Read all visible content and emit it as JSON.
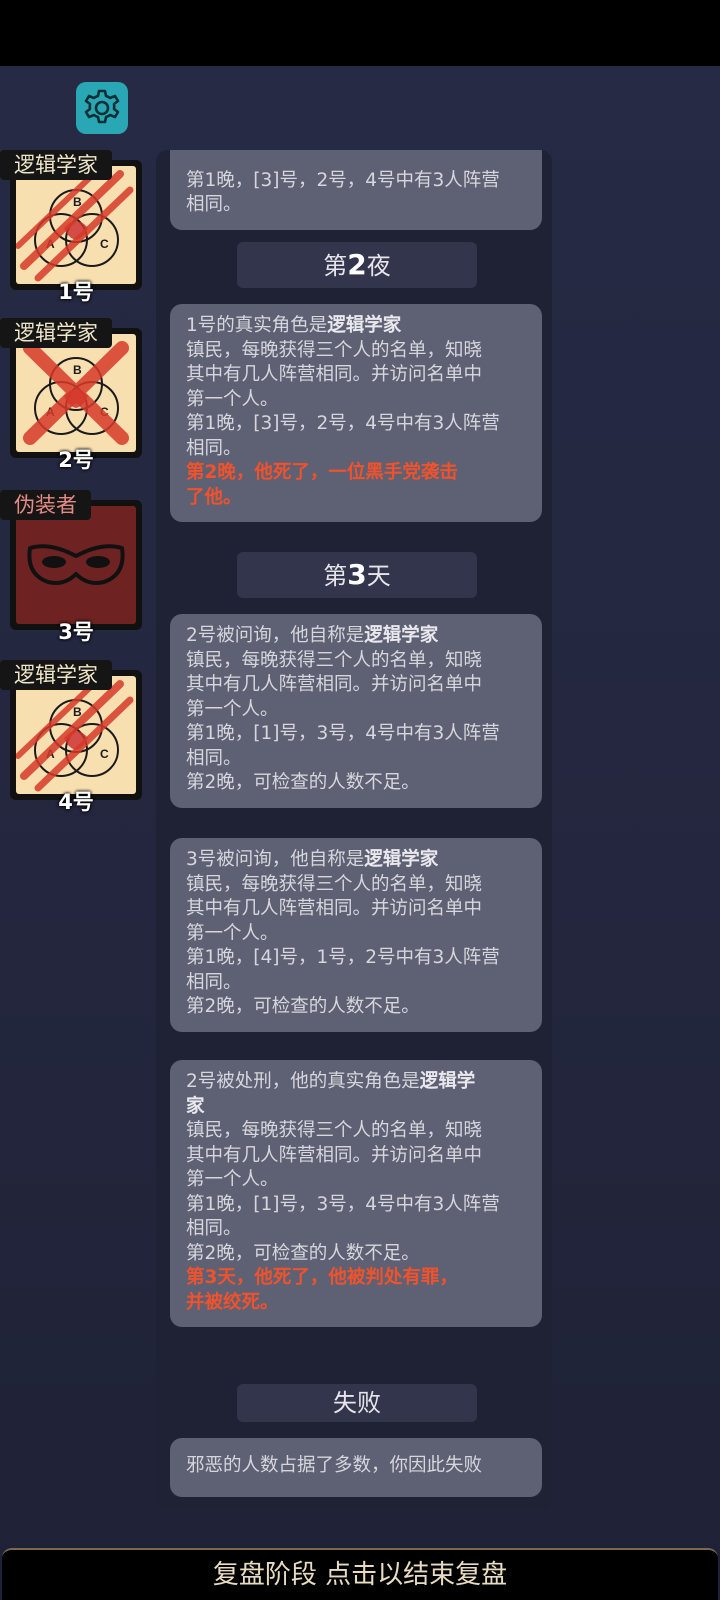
{
  "players": [
    {
      "role": "逻辑学家",
      "number": "1号",
      "faction": "good",
      "state": "attacked"
    },
    {
      "role": "逻辑学家",
      "number": "2号",
      "faction": "good",
      "state": "executed"
    },
    {
      "role": "伪装者",
      "number": "3号",
      "faction": "evil",
      "state": "alive"
    },
    {
      "role": "逻辑学家",
      "number": "4号",
      "faction": "good",
      "state": "attacked"
    }
  ],
  "log": {
    "m0": {
      "l1": "第1晚，[3]号，2号，4号中有3人阵营",
      "l2": "相同。"
    },
    "p_night2": {
      "a": "第",
      "b": "2",
      "c": "夜"
    },
    "m1": {
      "pre": "1号的真实角色是",
      "role": "逻辑学家",
      "d1": "镇民，每晚获得三个人的名单，知晓",
      "d2": "其中有几人阵营相同。并访问名单中",
      "d3": "第一个人。",
      "n1a": "第1晚，[3]号，2号，4号中有3人阵营",
      "n1b": "相同。",
      "r1": "第2晚，他死了，一位黑手党袭击",
      "r2": "了他。"
    },
    "p_day3": {
      "a": "第",
      "b": "3",
      "c": "天"
    },
    "m2": {
      "pre": "2号被问询，他自称是",
      "role": "逻辑学家",
      "d1": "镇民，每晚获得三个人的名单，知晓",
      "d2": "其中有几人阵营相同。并访问名单中",
      "d3": "第一个人。",
      "n1a": "第1晚，[1]号，3号，4号中有3人阵营",
      "n1b": "相同。",
      "n2": "第2晚，可检查的人数不足。"
    },
    "m3": {
      "pre": "3号被问询，他自称是",
      "role": "逻辑学家",
      "d1": "镇民，每晚获得三个人的名单，知晓",
      "d2": "其中有几人阵营相同。并访问名单中",
      "d3": "第一个人。",
      "n1a": "第1晚，[4]号，1号，2号中有3人阵营",
      "n1b": "相同。",
      "n2": "第2晚，可检查的人数不足。"
    },
    "m4": {
      "pre": "2号被处刑，他的真实角色是",
      "role_a": "逻辑学",
      "role_b": "家",
      "d1": "镇民，每晚获得三个人的名单，知晓",
      "d2": "其中有几人阵营相同。并访问名单中",
      "d3": "第一个人。",
      "n1a": "第1晚，[1]号，3号，4号中有3人阵营",
      "n1b": "相同。",
      "n2": "第2晚，可检查的人数不足。",
      "r1": "第3天，他死了，他被判处有罪，",
      "r2": "并被绞死。"
    },
    "p_fail": "失败",
    "m5": "邪恶的人数占据了多数，你因此失败"
  },
  "bottom_bar": "复盘阶段 点击以结束复盘",
  "colors": {
    "accent": "#2aa7b4",
    "highlight_red": "#f0522c",
    "evil_tag": "#e58a84"
  }
}
